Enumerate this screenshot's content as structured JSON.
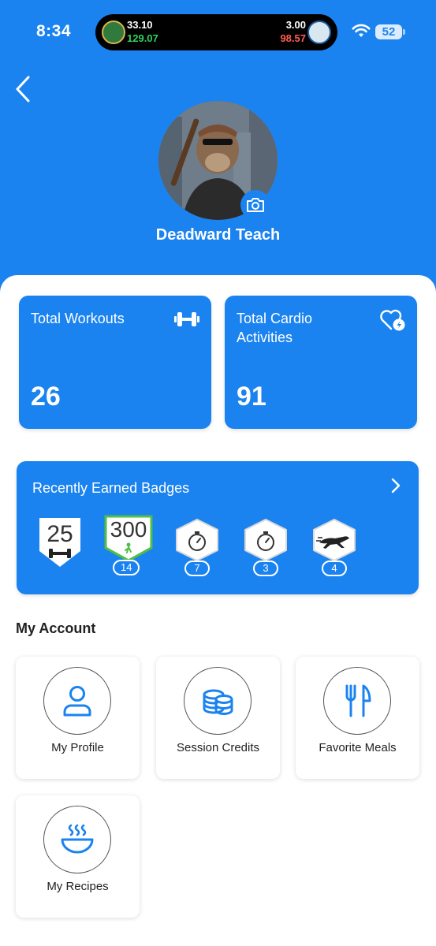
{
  "status_bar": {
    "time": "8:34",
    "ticker": {
      "left_top": "33.10",
      "left_bottom": "129.07",
      "right_top": "3.00",
      "right_bottom": "98.57"
    },
    "battery": "52"
  },
  "profile": {
    "name": "Deadward Teach"
  },
  "stats": [
    {
      "label": "Total Workouts",
      "value": "26",
      "icon": "dumbbell-icon"
    },
    {
      "label": "Total Cardio Activities",
      "value": "91",
      "icon": "heart-bolt-icon"
    }
  ],
  "badges": {
    "title": "Recently Earned Badges",
    "items": [
      {
        "text": "25",
        "count": "",
        "icon": "dumbbell-icon"
      },
      {
        "text": "300",
        "count": "14",
        "icon": "walking-icon"
      },
      {
        "text": "",
        "count": "7",
        "icon": "stopwatch-icon"
      },
      {
        "text": "",
        "count": "3",
        "icon": "stopwatch-icon"
      },
      {
        "text": "",
        "count": "4",
        "icon": "cheetah-icon"
      }
    ]
  },
  "account": {
    "title": "My Account",
    "tiles": [
      {
        "label": "My Profile",
        "icon": "person-icon"
      },
      {
        "label": "Session Credits",
        "icon": "coins-icon"
      },
      {
        "label": "Favorite Meals",
        "icon": "fork-knife-icon"
      },
      {
        "label": "My Recipes",
        "icon": "bowl-icon"
      }
    ]
  },
  "colors": {
    "primary": "#1a83f0",
    "gain": "#2fd35c",
    "loss": "#ff5d52"
  }
}
